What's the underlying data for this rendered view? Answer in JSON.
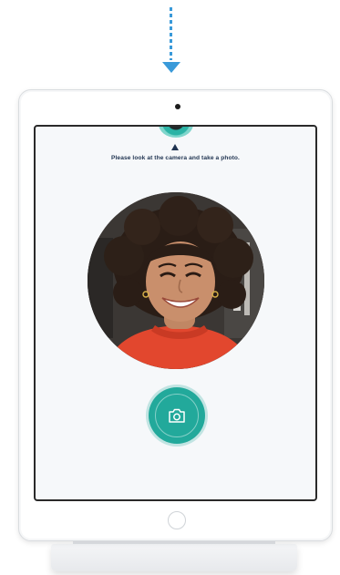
{
  "screen": {
    "instruction": "Please look at the camera and take a photo."
  },
  "icons": {
    "top_arrow": "dotted-arrow-down-icon",
    "pointer": "pointer-up-icon",
    "shutter": "camera-icon",
    "home": "home-button-icon"
  },
  "colors": {
    "accent": "#22a99b",
    "arrow": "#3a9ad9",
    "text": "#1f3350"
  }
}
